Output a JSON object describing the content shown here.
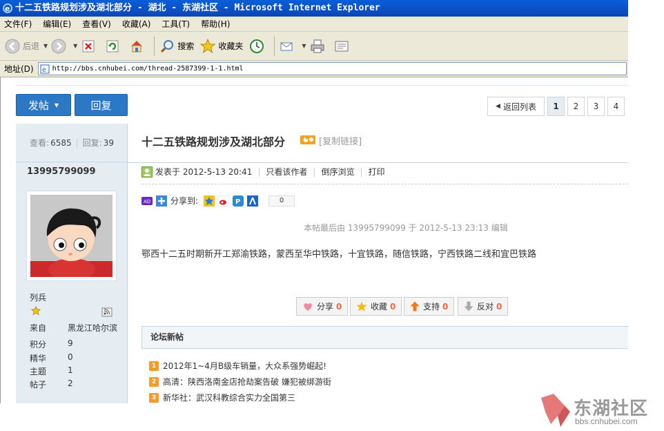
{
  "window": {
    "title": "十二五铁路规划涉及湖北部分 - 湖北 - 东湖社区 - Microsoft Internet Explorer"
  },
  "menubar": {
    "items": [
      "文件(F)",
      "编辑(E)",
      "查看(V)",
      "收藏(A)",
      "工具(T)",
      "帮助(H)"
    ]
  },
  "toolbar": {
    "back_label": "后退",
    "search_label": "搜索",
    "favorites_label": "收藏夹"
  },
  "address": {
    "label": "地址(D)",
    "url": "http://bbs.cnhubei.com/thread-2587399-1-1.html"
  },
  "actions": {
    "post_label": "发帖",
    "reply_label": "回复"
  },
  "pagination": {
    "back_label": "返回列表",
    "pages": [
      "1",
      "2",
      "3",
      "4"
    ],
    "current": "1"
  },
  "stats": {
    "views_label": "查看:",
    "views": "6585",
    "replies_label": "回复:",
    "replies": "39"
  },
  "author": {
    "name": "13995799099",
    "rank": "列兵",
    "profile": [
      {
        "key": "来自",
        "value": "黑龙江哈尔滨"
      },
      {
        "key": "积分",
        "value": "9"
      },
      {
        "key": "精华",
        "value": "0"
      },
      {
        "key": "主题",
        "value": "1"
      },
      {
        "key": "帖子",
        "value": "2"
      }
    ]
  },
  "thread": {
    "title": "十二五铁路规划涉及湖北部分",
    "copy_link": "[复制链接]",
    "posted_prefix": "发表于",
    "posted_at": "2012-5-13 20:41",
    "only_author": "只看该作者",
    "reverse_browse": "倒序浏览",
    "print": "打印",
    "share_to": "分享到:",
    "share_count": "0",
    "edit_note": "本帖最后由 13995799099 于 2012-5-13 23:13 编辑",
    "body": "鄂西十二五时期新开工郑渝铁路，蒙西至华中铁路，十宜铁路，随信铁路，宁西铁路二线和宜巴铁路"
  },
  "post_actions": [
    {
      "label": "分享",
      "count": "0"
    },
    {
      "label": "收藏",
      "count": "0"
    },
    {
      "label": "支持",
      "count": "0"
    },
    {
      "label": "反对",
      "count": "0"
    }
  ],
  "new_posts": {
    "heading": "论坛新帖",
    "items": [
      {
        "num": "1",
        "text": "2012年1~4月B级车销量，大众系强势崛起!"
      },
      {
        "num": "2",
        "text": "高清：陕西洛南金店抢劫案告破 嫌犯被绑游街"
      },
      {
        "num": "3",
        "text": "新华社：武汉科教综合实力全国第三"
      }
    ]
  },
  "watermark": {
    "name": "东湖社区",
    "url": "bbs.cnhubei.com"
  },
  "colors": {
    "accent_blue": "#2d78c4",
    "sidebar_bg": "#e5edf2",
    "count_orange": "#e86a4a"
  }
}
